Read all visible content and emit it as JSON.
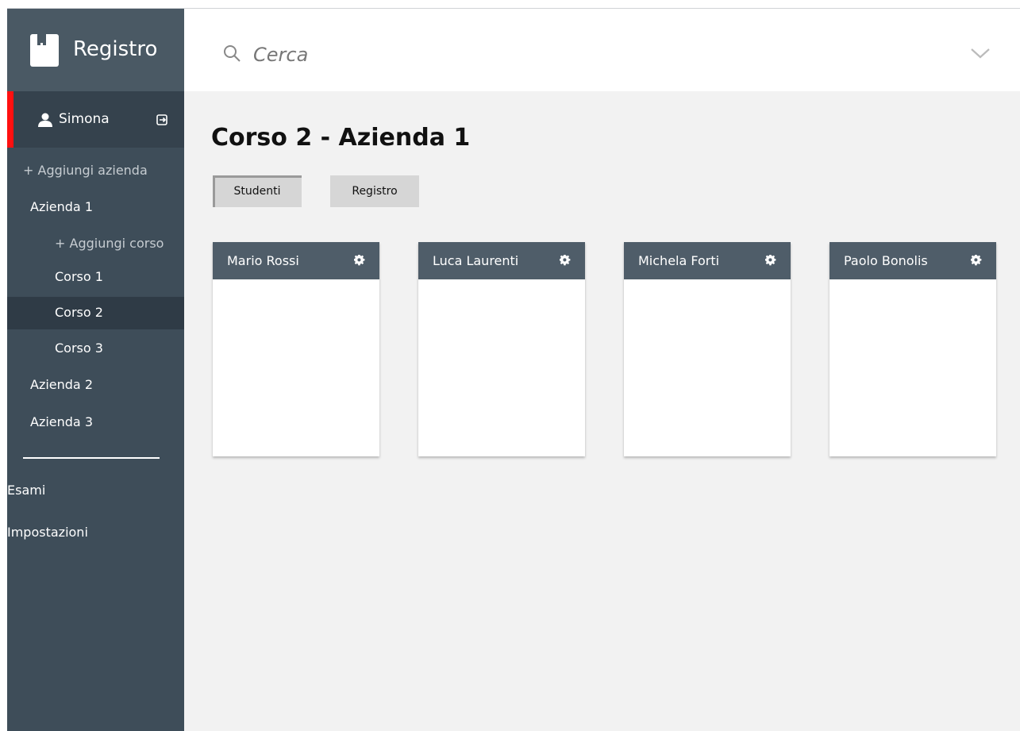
{
  "brand": {
    "title": "Registro",
    "icon": "bookmark-book-icon"
  },
  "user": {
    "name": "Simona",
    "icon": "user-icon",
    "logout_icon": "logout-icon"
  },
  "nav": {
    "add_company": "+ Aggiungi azienda",
    "company1": "Azienda 1",
    "add_course": "+ Aggiungi corso",
    "course1": "Corso 1",
    "course2": "Corso 2",
    "course3": "Corso 3",
    "company2": "Azienda 2",
    "company3": "Azienda 3",
    "exams": "Esami",
    "settings": "Impostazioni",
    "selected": "Corso 2"
  },
  "search": {
    "placeholder": "Cerca",
    "icon": "search-icon",
    "dropdown_icon": "chevron-down-icon"
  },
  "page": {
    "title": "Corso 2 - Azienda 1"
  },
  "tabs": [
    {
      "label": "Studenti",
      "active": true
    },
    {
      "label": "Registro",
      "active": false
    }
  ],
  "students": [
    {
      "name": "Mario Rossi"
    },
    {
      "name": "Luca Laurenti"
    },
    {
      "name": "Michela Forti"
    },
    {
      "name": "Paolo Bonolis"
    }
  ],
  "colors": {
    "sidebar": "#3e4d59",
    "sidebar_header": "#4a5964",
    "user_row": "#35424d",
    "accent": "#ff1010",
    "card_header": "#4f5d69",
    "main_bg": "#f2f2f2"
  }
}
